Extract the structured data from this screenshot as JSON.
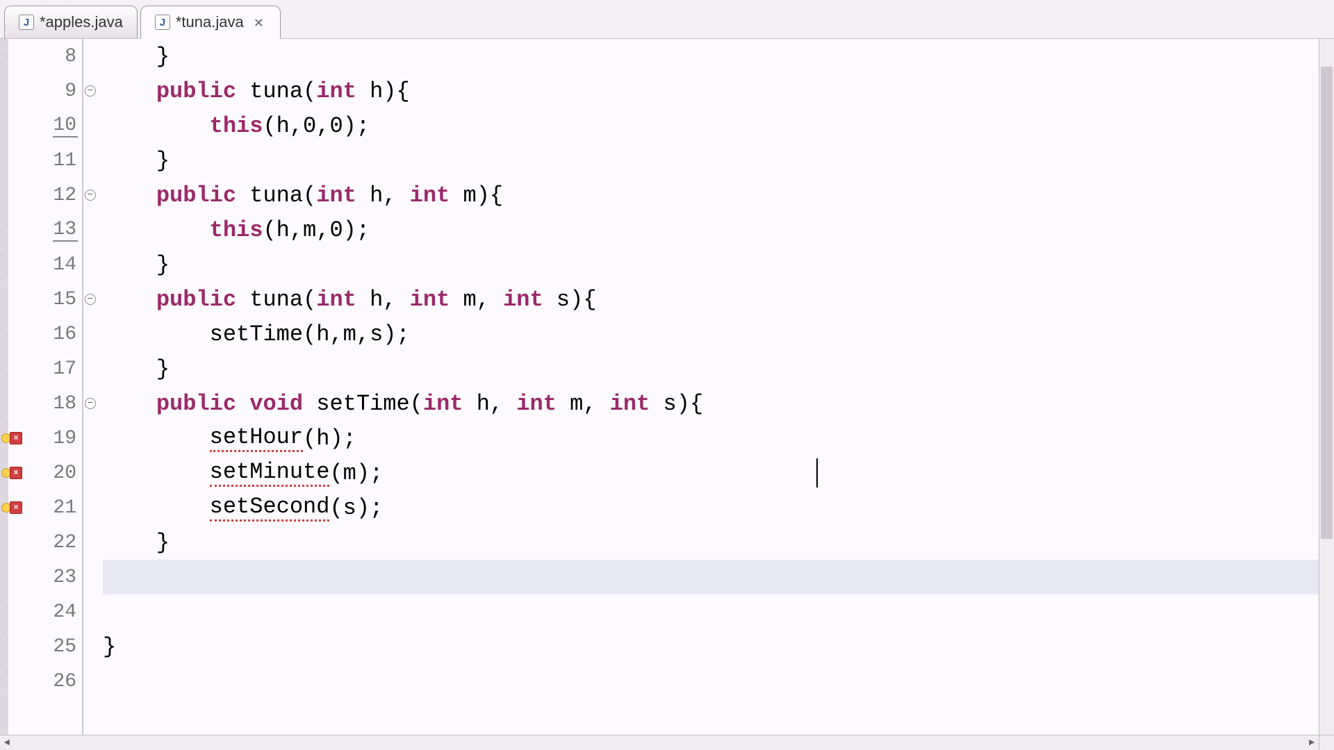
{
  "tabs": [
    {
      "label": "*apples.java",
      "active": false
    },
    {
      "label": "*tuna.java",
      "active": true
    }
  ],
  "visibleLines": {
    "start": 8,
    "end": 26
  },
  "code": {
    "l8": "    }",
    "l9p": "    ",
    "l9k1": "public",
    "l9m": " tuna(",
    "l9k2": "int",
    "l9e": " h){",
    "l10p": "        ",
    "l10k": "this",
    "l10e": "(h,0,0);",
    "l11": "    }",
    "l12p": "    ",
    "l12k1": "public",
    "l12m": " tuna(",
    "l12k2": "int",
    "l12m2": " h, ",
    "l12k3": "int",
    "l12e": " m){",
    "l13p": "        ",
    "l13k": "this",
    "l13e": "(h,m,0);",
    "l14": "    }",
    "l15p": "    ",
    "l15k1": "public",
    "l15m": " tuna(",
    "l15k2": "int",
    "l15m2": " h, ",
    "l15k3": "int",
    "l15m3": " m, ",
    "l15k4": "int",
    "l15e": " s){",
    "l16": "        setTime(h,m,s);",
    "l17": "    }",
    "l18p": "    ",
    "l18k1": "public",
    "l18s1": " ",
    "l18k2": "void",
    "l18m": " setTime(",
    "l18k3": "int",
    "l18m2": " h, ",
    "l18k4": "int",
    "l18m3": " m, ",
    "l18k5": "int",
    "l18e": " s){",
    "l19p": "        ",
    "l19u": "setHour",
    "l19e": "(h);",
    "l20p": "        ",
    "l20u": "setMinute",
    "l20e": "(m);",
    "l21p": "        ",
    "l21u": "setSecond",
    "l21e": "(s);",
    "l22": "    }",
    "l23": "    ",
    "l24": "",
    "l25": "}",
    "l26": ""
  },
  "gutterMarkers": {
    "foldable": [
      9,
      12,
      15,
      18
    ],
    "errors": [
      19,
      20,
      21
    ],
    "warnUnderline": [
      10,
      13
    ]
  },
  "icons": {
    "j": "J",
    "close": "✕",
    "minus": "−",
    "error": "×",
    "left": "◄",
    "right": "►"
  }
}
